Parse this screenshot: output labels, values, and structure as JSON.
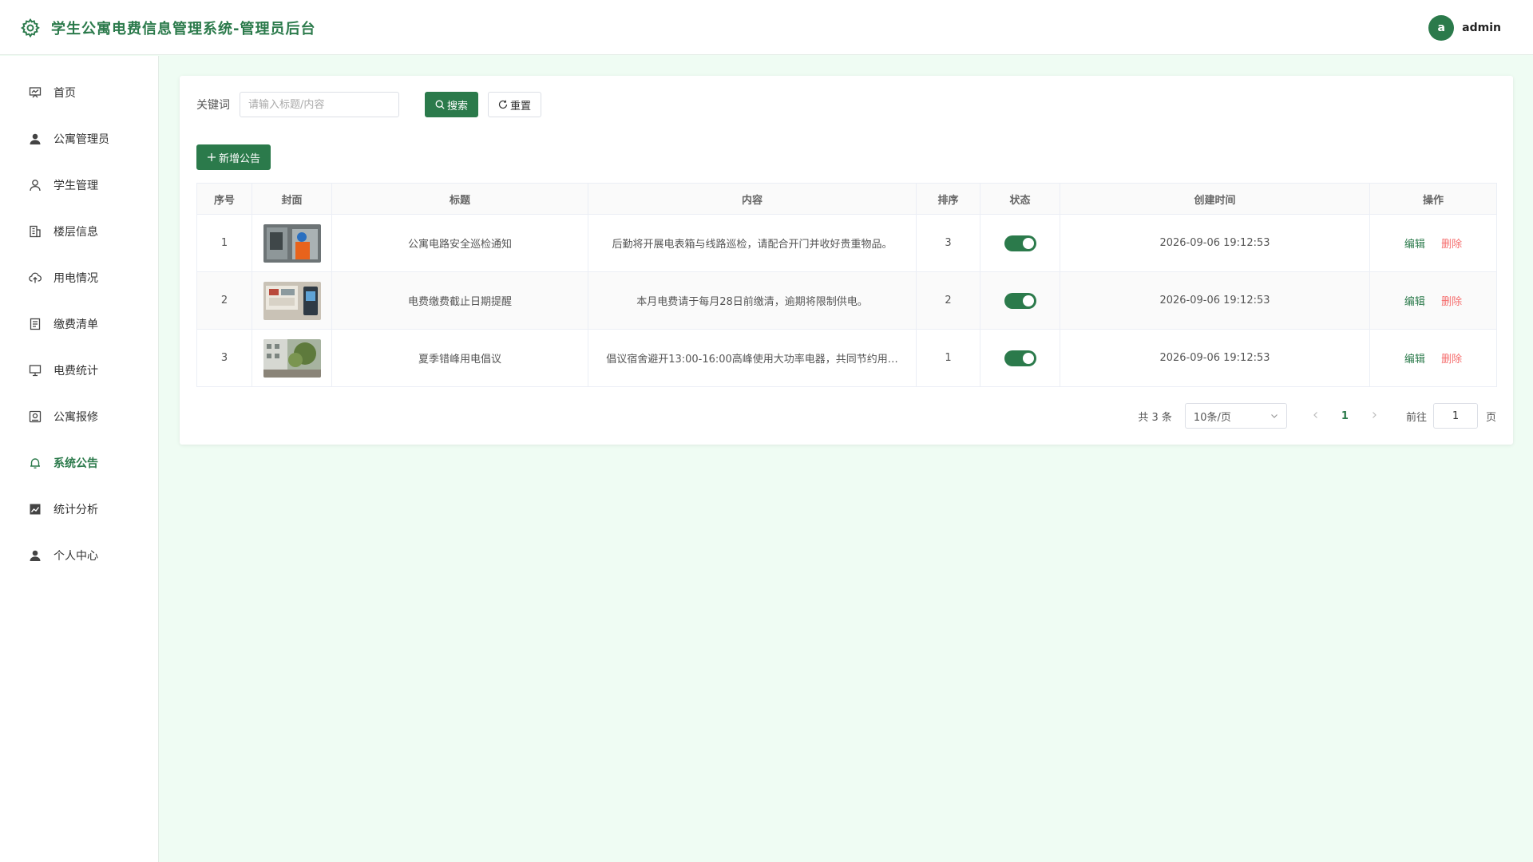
{
  "header": {
    "title": "学生公寓电费信息管理系统-管理员后台",
    "avatar_letter": "a",
    "username": "admin"
  },
  "sidebar": {
    "items": [
      {
        "label": "首页",
        "icon": "presentation-icon"
      },
      {
        "label": "公寓管理员",
        "icon": "user-solid-icon"
      },
      {
        "label": "学生管理",
        "icon": "user-icon"
      },
      {
        "label": "楼层信息",
        "icon": "building-icon"
      },
      {
        "label": "用电情况",
        "icon": "cloud-upload-icon"
      },
      {
        "label": "缴费清单",
        "icon": "document-icon"
      },
      {
        "label": "电费统计",
        "icon": "monitor-icon"
      },
      {
        "label": "公寓报修",
        "icon": "tools-icon"
      },
      {
        "label": "系统公告",
        "icon": "bell-icon"
      },
      {
        "label": "统计分析",
        "icon": "chart-icon"
      },
      {
        "label": "个人中心",
        "icon": "user-solid-icon"
      }
    ],
    "active_index": 8
  },
  "search": {
    "label": "关键词",
    "placeholder": "请输入标题/内容",
    "search_label": "搜索",
    "reset_label": "重置"
  },
  "toolbar": {
    "add_label": "新增公告"
  },
  "table": {
    "columns": [
      "序号",
      "封面",
      "标题",
      "内容",
      "排序",
      "状态",
      "创建时间",
      "操作"
    ],
    "rows": [
      {
        "index": "1",
        "title": "公寓电路安全巡检通知",
        "content": "后勤将开展电表箱与线路巡检，请配合开门并收好贵重物品。",
        "sort": "3",
        "status": true,
        "created": "2026-09-06 19:12:53"
      },
      {
        "index": "2",
        "title": "电费缴费截止日期提醒",
        "content": "本月电费请于每月28日前缴清，逾期将限制供电。",
        "sort": "2",
        "status": true,
        "created": "2026-09-06 19:12:53"
      },
      {
        "index": "3",
        "title": "夏季错峰用电倡议",
        "content": "倡议宿舍避开13:00-16:00高峰使用大功率电器，共同节约用…",
        "sort": "1",
        "status": true,
        "created": "2026-09-06 19:12:53"
      }
    ],
    "edit_label": "编辑",
    "delete_label": "删除"
  },
  "pagination": {
    "total_text": "共 3 条",
    "page_size": "10条/页",
    "current_page": "1",
    "goto_label": "前往",
    "goto_value": "1",
    "page_suffix": "页"
  },
  "colors": {
    "primary": "#2b7a4b",
    "danger": "#f56c6c",
    "background": "#effcf3"
  }
}
